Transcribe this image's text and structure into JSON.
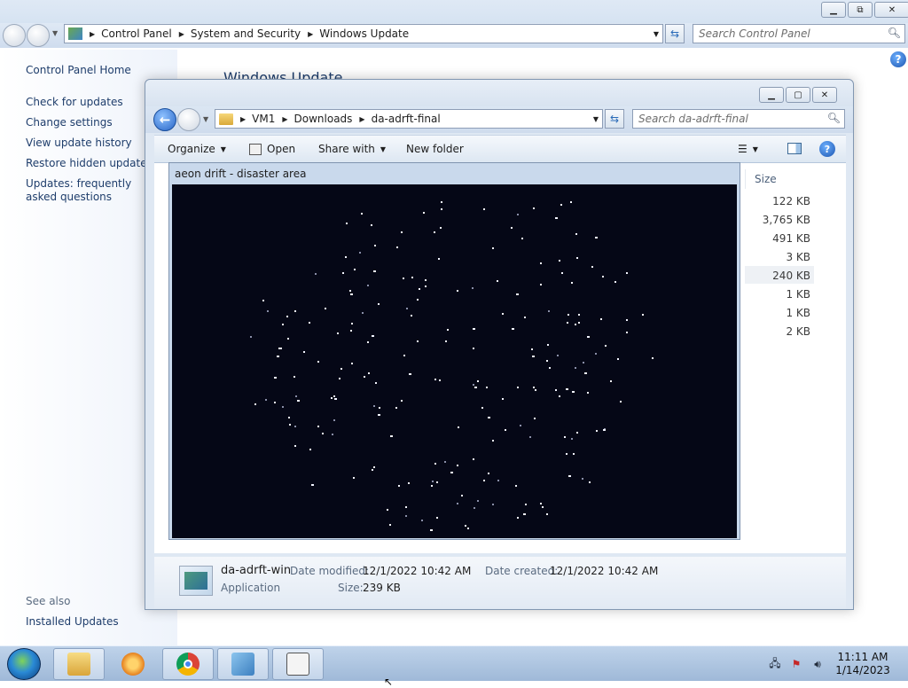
{
  "control_panel": {
    "breadcrumbs": [
      "Control Panel",
      "System and Security",
      "Windows Update"
    ],
    "search_placeholder": "Search Control Panel",
    "main_title": "Windows Update",
    "sidebar": {
      "home": "Control Panel Home",
      "links": [
        "Check for updates",
        "Change settings",
        "View update history",
        "Restore hidden updates",
        "Updates: frequently asked questions"
      ],
      "see_also": "See also",
      "installed_updates": "Installed Updates"
    }
  },
  "explorer": {
    "breadcrumbs": [
      "VM1",
      "Downloads",
      "da-adrft-final"
    ],
    "search_placeholder": "Search da-adrft-final",
    "toolbar": {
      "organize": "Organize",
      "open": "Open",
      "share_with": "Share with",
      "new_folder": "New folder"
    },
    "size_header": "Size",
    "sizes": [
      "122 KB",
      "3,765 KB",
      "491 KB",
      "3 KB",
      "240 KB",
      "1 KB",
      "1 KB",
      "2 KB"
    ],
    "details": {
      "file_name": "da-adrft-win",
      "file_type": "Application",
      "date_modified_label": "Date modified:",
      "date_modified": "12/1/2022 10:42 AM",
      "date_created_label": "Date created:",
      "date_created": "12/1/2022 10:42 AM",
      "size_label": "Size:",
      "size": "239 KB"
    }
  },
  "game": {
    "title": "aeon drift - disaster area"
  },
  "taskbar": {
    "time": "11:11 AM",
    "date": "1/14/2023"
  },
  "icons": [
    "back-icon",
    "forward-icon",
    "folder-icon",
    "refresh-icon",
    "search-icon",
    "help-icon",
    "open-icon",
    "view-icon",
    "preview-pane-icon",
    "start-orb-icon",
    "explorer-icon",
    "media-player-icon",
    "chrome-icon",
    "control-panel-icon",
    "app-icon",
    "network-icon",
    "action-center-icon",
    "volume-icon"
  ]
}
